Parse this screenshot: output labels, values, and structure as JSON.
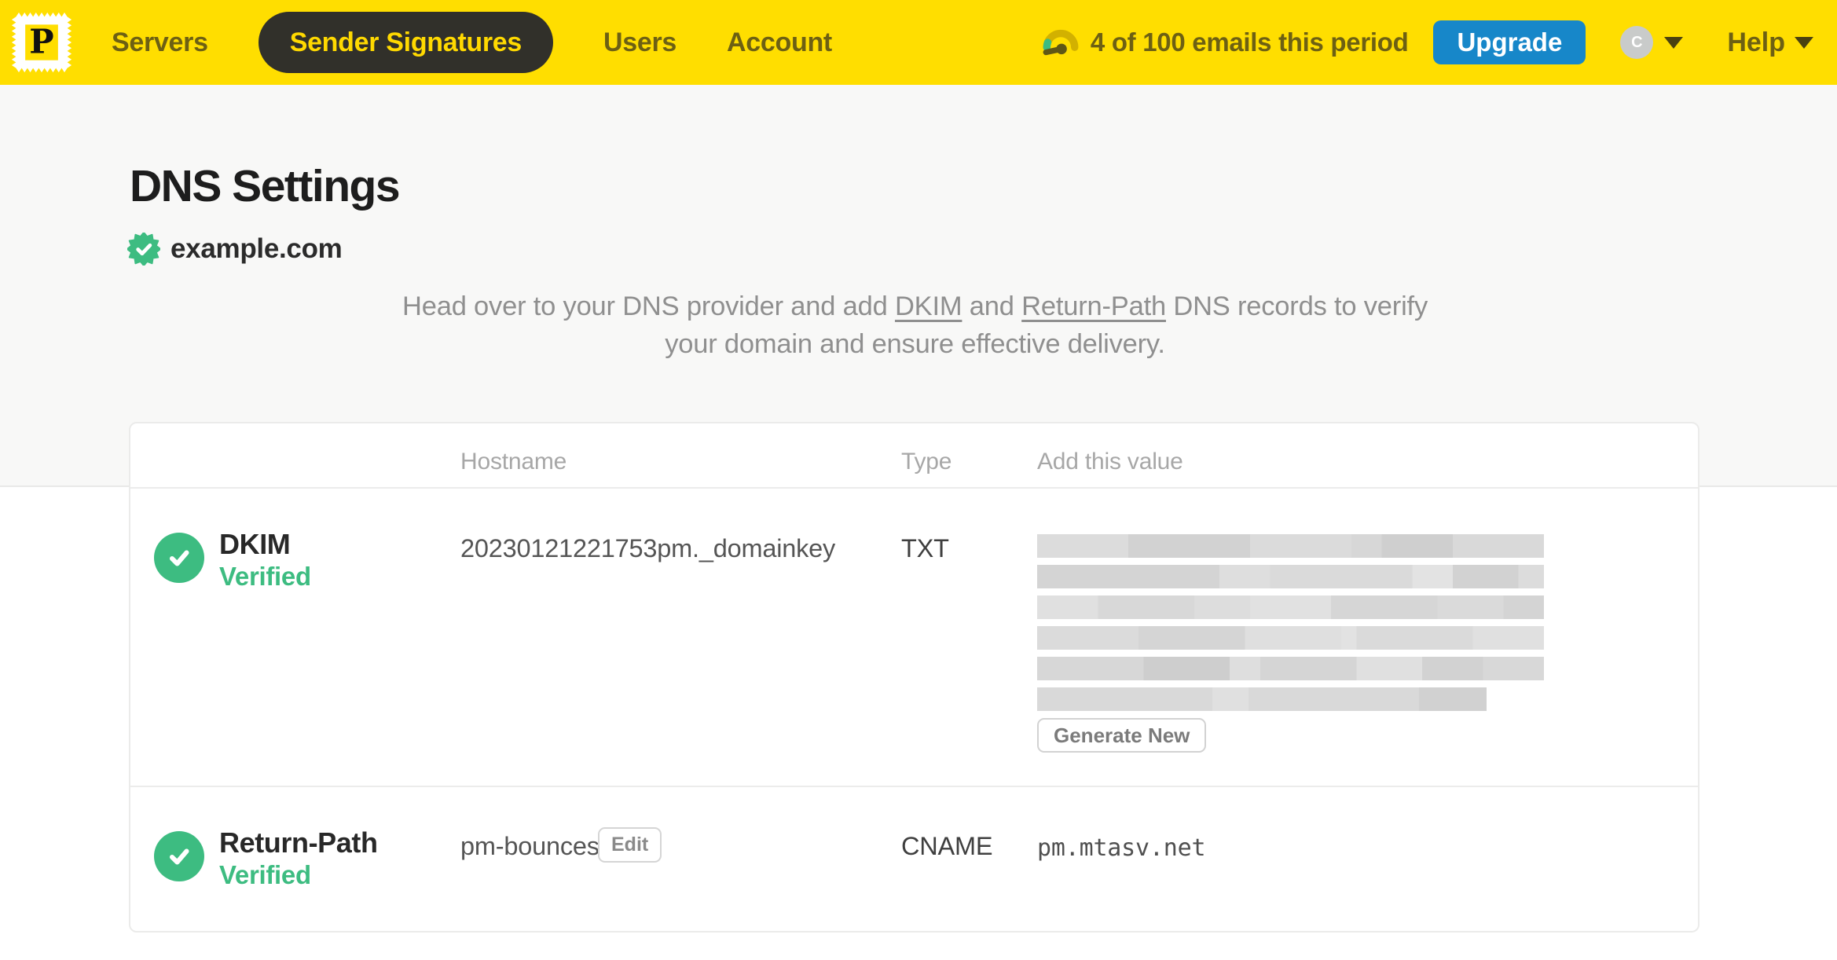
{
  "header": {
    "logo_letter": "P",
    "nav": [
      {
        "label": "Servers",
        "active": false
      },
      {
        "label": "Sender Signatures",
        "active": true
      },
      {
        "label": "Users",
        "active": false
      },
      {
        "label": "Account",
        "active": false
      }
    ],
    "usage_text": "4 of 100 emails this period",
    "upgrade_label": "Upgrade",
    "avatar_initial": "C",
    "help_label": "Help"
  },
  "page": {
    "title": "DNS Settings",
    "domain": "example.com",
    "domain_verified": true,
    "intro_prefix": "Head over to your DNS provider and add ",
    "intro_link_dkim": "DKIM",
    "intro_middle": " and ",
    "intro_link_return_path": "Return-Path",
    "intro_suffix": " DNS records to verify your domain and ensure effective delivery."
  },
  "table": {
    "headers": {
      "hostname": "Hostname",
      "type": "Type",
      "value": "Add this value"
    },
    "rows": [
      {
        "name": "DKIM",
        "status": "Verified",
        "hostname": "20230121221753pm._domainkey",
        "type": "TXT",
        "value_redacted": true,
        "value_redacted_lines": 6,
        "action_label": "Generate New"
      },
      {
        "name": "Return-Path",
        "status": "Verified",
        "hostname": "pm-bounces",
        "edit_label": "Edit",
        "type": "CNAME",
        "value": "pm.mtasv.net"
      }
    ]
  },
  "colors": {
    "brand_yellow": "#ffde00",
    "nav_text_olive": "#6d6013",
    "active_pill_bg": "#31302a",
    "upgrade_blue": "#1787c9",
    "verified_green": "#3dbc81",
    "muted_gray": "#8f8f8f"
  }
}
